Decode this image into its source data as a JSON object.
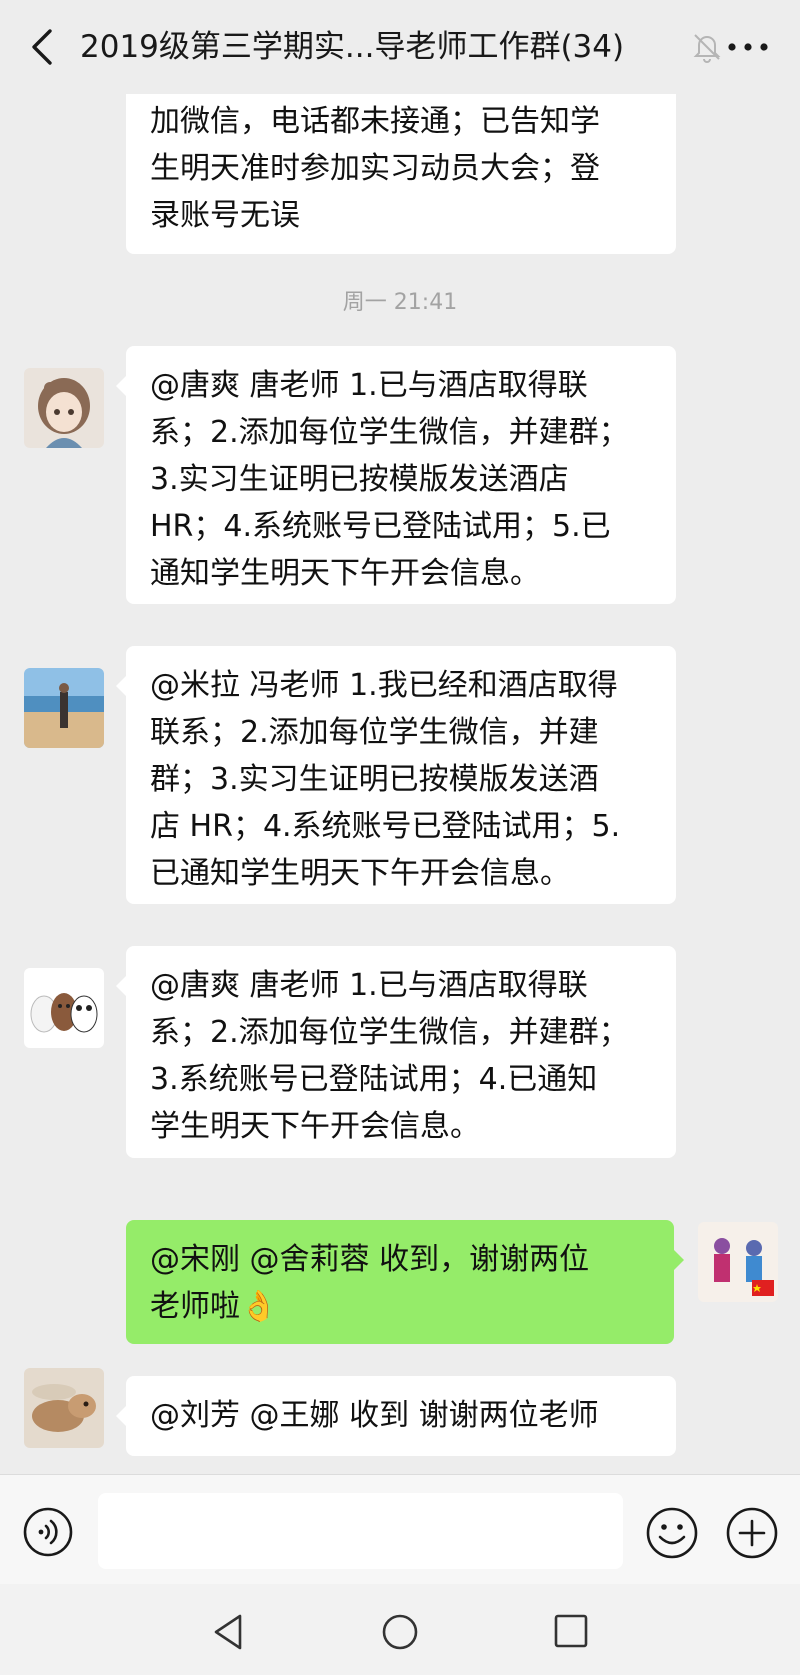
{
  "header": {
    "title": "2019级第三学期实...导老师工作群(34)",
    "icons": {
      "back": "chevron-left-icon",
      "mute": "bell-off-icon",
      "more": "more-dots-icon"
    }
  },
  "messages": {
    "partial": {
      "lines": [
        "加微信，电话都未接通；已告知学",
        "生明天准时参加实习动员大会；登",
        "录账号无误"
      ]
    },
    "timestamp": "周一 21:41",
    "m1": {
      "lines": [
        "@唐爽  唐老师 1.已与酒店取得联",
        "系；2.添加每位学生微信，并建群；",
        "3.实习生证明已按模版发送酒店",
        "HR；4.系统账号已登陆试用；5.已",
        "通知学生明天下午开会信息。"
      ]
    },
    "m2": {
      "lines": [
        "@米拉 冯老师 1.我已经和酒店取得",
        "联系；2.添加每位学生微信，并建",
        "群；3.实习生证明已按模版发送酒",
        "店 HR；4.系统账号已登陆试用；5.",
        "已通知学生明天下午开会信息。"
      ]
    },
    "m3": {
      "lines": [
        "@唐爽  唐老师 1.已与酒店取得联",
        "系；2.添加每位学生微信，并建群；",
        "3.系统账号已登陆试用；4.已通知",
        "学生明天下午开会信息。"
      ]
    },
    "m4": {
      "lines": [
        "@宋刚  @舍莉蓉  收到，谢谢两位",
        "老师啦👌"
      ]
    },
    "m5": {
      "lines": [
        "@刘芳  @王娜  收到 谢谢两位老师"
      ]
    }
  },
  "input": {
    "placeholder": ""
  },
  "colors": {
    "background": "#ededed",
    "self_bubble": "#95ec69",
    "other_bubble": "#ffffff",
    "timestamp": "#a3a3a3"
  }
}
